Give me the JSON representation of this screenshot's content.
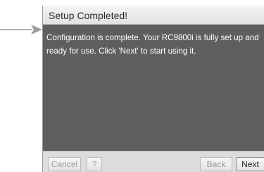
{
  "dialog": {
    "title": "Setup Completed!",
    "message": "Configuration is complete. Your RC9800i is fully set up and ready for use. Click 'Next' to start using it."
  },
  "buttons": {
    "cancel": "Cancel",
    "help": "?",
    "back": "Back",
    "next": "Next"
  },
  "colors": {
    "dialog_body": "#5e5e5e",
    "header_background": "#eeeeee",
    "button_bar": "#dcdcdc",
    "disabled_text": "#9a9a9a",
    "pointer_arrow": "#9c9c9c"
  },
  "icons": {
    "pointer": "right-arrow-pointer-icon"
  }
}
